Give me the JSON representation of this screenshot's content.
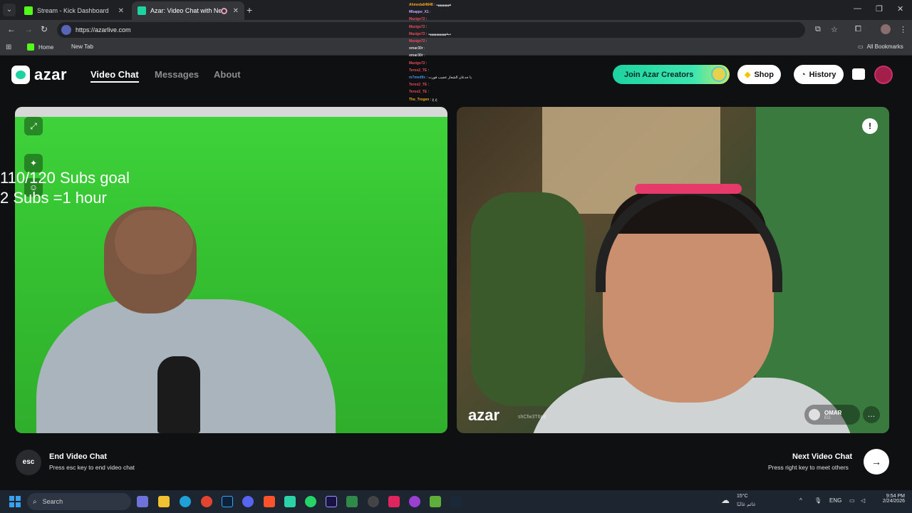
{
  "browser": {
    "tabs": [
      {
        "title": "Stream - Kick Dashboard",
        "active": false
      },
      {
        "title": "Azar: Video Chat with New",
        "active": true
      }
    ],
    "url": "https://azarlive.com",
    "bookmarks": [
      "Home",
      "New Tab"
    ],
    "all_bookmarks_label": "All Bookmarks"
  },
  "site": {
    "logo": "azar",
    "nav": [
      "Video Chat",
      "Messages",
      "About"
    ],
    "buttons": {
      "creators": "Join Azar Creators",
      "shop": "Shop",
      "history": "History"
    }
  },
  "stream_overlay": {
    "line1": "110/120 Subs goal",
    "line2": "2 Subs =1 hour"
  },
  "remote_peer": {
    "watermark": "azar",
    "watermark_id": "shCfw3T6p8",
    "name": "OMAR",
    "country": "EG"
  },
  "controls": {
    "end_key": "esc",
    "end_title": "End Video Chat",
    "end_hint": "Press esc key to end video chat",
    "next_title": "Next Video Chat",
    "next_hint": "Press right key to meet others"
  },
  "stream_chat": [
    {
      "user": "Ahmedali4848",
      "msg": "ههههههههه"
    },
    {
      "user": "Mbappe_X1",
      "msg": ""
    },
    {
      "user": "Mazigo72",
      "msg": ""
    },
    {
      "user": "Mazigo72",
      "msg": ""
    },
    {
      "user": "Mazigo72",
      "msg": "ميقههههههههههه"
    },
    {
      "user": "Mazigo72",
      "msg": ""
    },
    {
      "user": "omar30r",
      "msg": ""
    },
    {
      "user": "omar30r",
      "msg": ""
    },
    {
      "user": "Mazigo72",
      "msg": ""
    },
    {
      "user": "Terox2_TE",
      "msg": ""
    },
    {
      "user": "m7med9x",
      "msg": "يا جدعان الشعار عجيب فورت"
    },
    {
      "user": "Terox2_TE",
      "msg": ""
    },
    {
      "user": "Terox2_TE",
      "msg": ""
    },
    {
      "user": "The_Trogen",
      "msg": "ع ع"
    }
  ],
  "taskbar": {
    "search_label": "Search",
    "weather_temp": "15°C",
    "weather_desc": "غائم غالبًا",
    "lang": "ENG",
    "time": "9:54 PM",
    "date": "2/24/2026"
  },
  "colors": {
    "azar_green": "#1dd3a0",
    "kick_green": "#53fc18",
    "page_bg": "#0f1012"
  }
}
